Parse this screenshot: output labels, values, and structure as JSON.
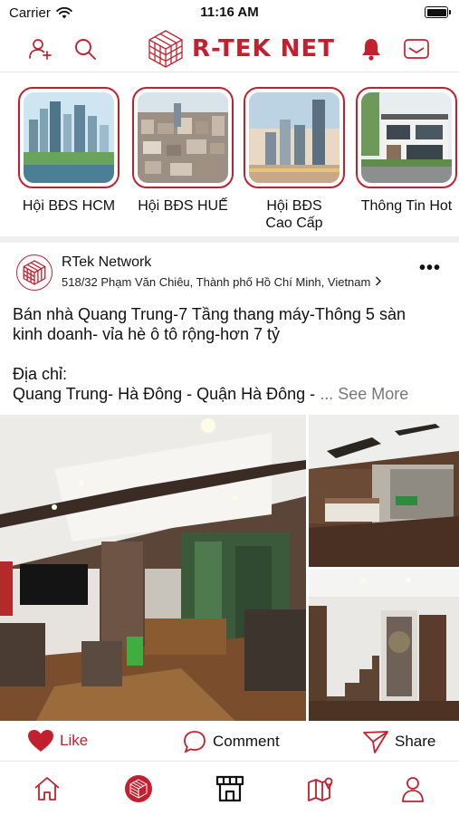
{
  "status_bar": {
    "carrier": "Carrier",
    "time": "11:16 AM"
  },
  "header": {
    "brand": "R-TEK NET"
  },
  "categories": [
    {
      "label": "Hội BĐS HCM"
    },
    {
      "label": "Hội BĐS HUẾ"
    },
    {
      "label_line1": "Hội BĐS",
      "label_line2": "Cao Cấp"
    },
    {
      "label": "Thông Tin Hot"
    }
  ],
  "post": {
    "author": "RTek Network",
    "location": "518/32 Phạm Văn Chiêu, Thành phố Hồ Chí Minh, Vietnam",
    "text_line1": "Bán nhà Quang Trung-7 Tầng thang máy-Thông 5 sàn",
    "text_line2": "kinh doanh- vỉa hè ô tô rộng-hơn 7 tỷ",
    "address_label": "Địa chỉ:",
    "address_value": "Quang Trung- Hà Đông - Quận Hà Đông -",
    "see_more": "... See More"
  },
  "actions": {
    "like": "Like",
    "comment": "Comment",
    "share": "Share"
  },
  "colors": {
    "accent": "#c2202e",
    "divider": "#efefef",
    "muted": "#777777"
  },
  "icons": {
    "header": [
      "add-user-icon",
      "search-icon",
      "bell-icon",
      "mail-icon"
    ],
    "tabs": [
      "home-icon",
      "network-logo-icon",
      "store-icon",
      "map-icon",
      "profile-icon"
    ]
  }
}
